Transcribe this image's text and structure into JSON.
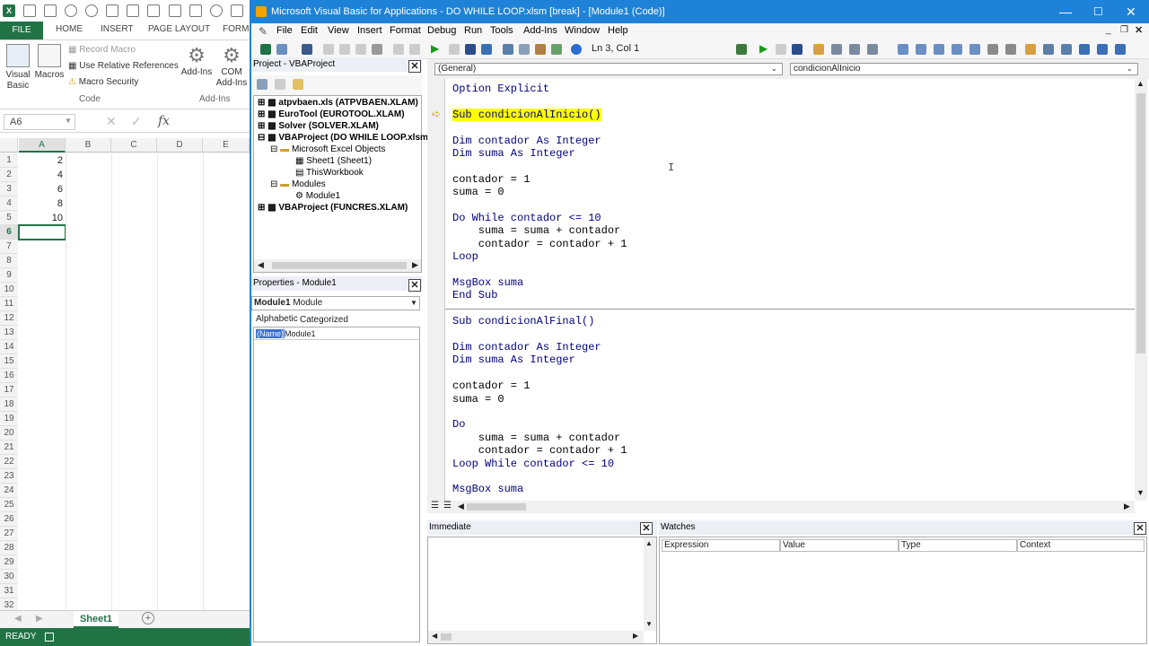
{
  "excel": {
    "logo": "X",
    "tabs": [
      "FILE",
      "HOME",
      "INSERT",
      "PAGE LAYOUT",
      "FORMU"
    ],
    "ribbon": {
      "visual_basic": "Visual Basic",
      "macros": "Macros",
      "record_macro": "Record Macro",
      "use_relative": "Use Relative References",
      "macro_security": "Macro Security",
      "group_code": "Code",
      "addins": "Add-Ins",
      "com_addins": "COM Add-Ins",
      "group_addins": "Add-Ins"
    },
    "name_box": "A6",
    "fx": "fx",
    "columns": [
      "A",
      "B",
      "C",
      "D",
      "E"
    ],
    "rows": [
      "1",
      "2",
      "3",
      "4",
      "5",
      "6",
      "7",
      "8",
      "9",
      "10",
      "11",
      "12",
      "13",
      "14",
      "15",
      "16",
      "17",
      "18",
      "19",
      "20",
      "21",
      "22",
      "23",
      "24",
      "25",
      "26",
      "27",
      "28",
      "29",
      "30",
      "31",
      "32"
    ],
    "cells_a": [
      "2",
      "4",
      "6",
      "8",
      "10"
    ],
    "sheet_tab": "Sheet1",
    "status": "READY"
  },
  "vbe": {
    "title": "Microsoft Visual Basic for Applications - DO WHILE LOOP.xlsm [break] - [Module1 (Code)]",
    "menu": [
      "File",
      "Edit",
      "View",
      "Insert",
      "Format",
      "Debug",
      "Run",
      "Tools",
      "Add-Ins",
      "Window",
      "Help"
    ],
    "position": "Ln 3, Col 1",
    "project": {
      "title": "Project - VBAProject",
      "items": [
        "atpvbaen.xls (ATPVBAEN.XLAM)",
        "EuroTool (EUROTOOL.XLAM)",
        "Solver (SOLVER.XLAM)",
        "VBAProject (DO WHILE LOOP.xlsm)",
        "Microsoft Excel Objects",
        "Sheet1 (Sheet1)",
        "ThisWorkbook",
        "Modules",
        "Module1",
        "VBAProject (FUNCRES.XLAM)"
      ]
    },
    "properties": {
      "title": "Properties - Module1",
      "object": "Module1",
      "object_type": "Module",
      "tab_alpha": "Alphabetic",
      "tab_cat": "Categorized",
      "name_key": "(Name)",
      "name_val": "Module1"
    },
    "combo_general": "(General)",
    "combo_proc": "condicionAlInicio",
    "code_lines": [
      "Option Explicit",
      "",
      "Sub condicionAlInicio()",
      "",
      "Dim contador As Integer",
      "Dim suma As Integer",
      "",
      "contador = 1",
      "suma = 0",
      "",
      "Do While contador <= 10",
      "    suma = suma + contador",
      "    contador = contador + 1",
      "Loop",
      "",
      "MsgBox suma",
      "End Sub",
      "",
      "Sub condicionAlFinal()",
      "",
      "Dim contador As Integer",
      "Dim suma As Integer",
      "",
      "contador = 1",
      "suma = 0",
      "",
      "Do",
      "    suma = suma + contador",
      "    contador = contador + 1",
      "Loop While contador <= 10",
      "",
      "MsgBox suma"
    ],
    "immediate_title": "Immediate",
    "watches_title": "Watches",
    "watch_cols": [
      "Expression",
      "Value",
      "Type",
      "Context"
    ],
    "highlight_color": "#ffff00",
    "titlebar_color": "#1e83d8"
  }
}
